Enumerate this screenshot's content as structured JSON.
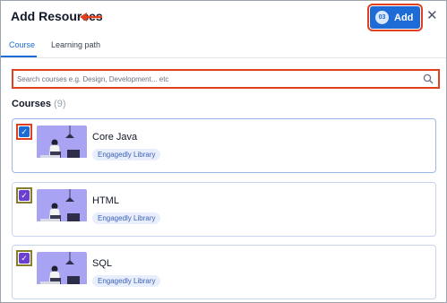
{
  "header": {
    "title": "Add Resources",
    "add_count": "03",
    "add_label": "Add"
  },
  "tabs": [
    {
      "label": "Course",
      "active": true
    },
    {
      "label": "Learning path",
      "active": false
    }
  ],
  "search": {
    "placeholder": "Search courses e.g. Design, Development... etc"
  },
  "section": {
    "title": "Courses",
    "count": "(9)"
  },
  "courses": [
    {
      "name": "Core Java",
      "badge": "Engagedly Library",
      "checked": true
    },
    {
      "name": "HTML",
      "badge": "Engagedly Library",
      "checked": true
    },
    {
      "name": "SQL",
      "badge": "Engagedly Library",
      "checked": true
    }
  ],
  "colors": {
    "accent": "#1d6bd6",
    "annotation": "#e0401f",
    "checkbox_first": "#1d6bd6",
    "checkbox_other": "#6b3fd0",
    "thumb_bg": "#a9a3f3"
  }
}
